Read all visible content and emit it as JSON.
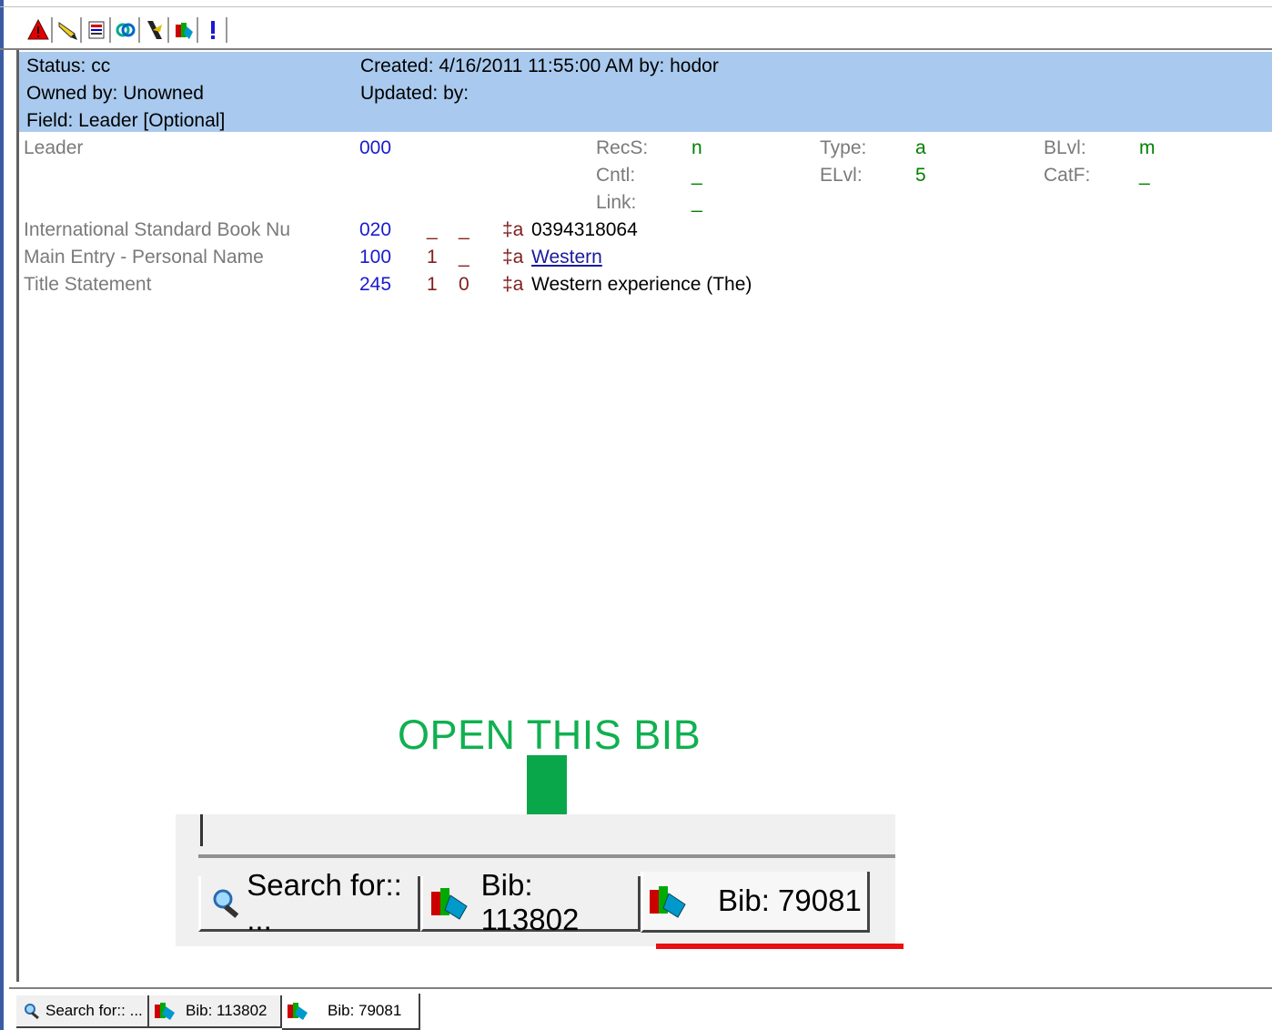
{
  "header": {
    "status": "Status: cc",
    "owned": "Owned by: Unowned",
    "field": "Field: Leader [Optional]",
    "created": "Created: 4/16/2011 11:55:00 AM by: hodor",
    "updated": "Updated:  by:"
  },
  "leader": {
    "label": "Leader",
    "tag": "000",
    "recs_label": "RecS:",
    "recs_val": "n",
    "cntl_label": "Cntl:",
    "cntl_val": "_",
    "link_label": "Link:",
    "link_val": "_",
    "type_label": "Type:",
    "type_val": "a",
    "elvl_label": "ELvl:",
    "elvl_val": "5",
    "blvl_label": "BLvl:",
    "blvl_val": "m",
    "catf_label": "CatF:",
    "catf_val": "_"
  },
  "fields": [
    {
      "label": "International Standard Book Nu",
      "tag": "020",
      "ind1": "_",
      "ind2": "_",
      "subfield": "‡a",
      "value": "0394318064"
    },
    {
      "label": "Main Entry - Personal Name",
      "tag": "100",
      "ind1": "1",
      "ind2": "_",
      "subfield": "‡a",
      "value": "Western"
    },
    {
      "label": "Title Statement",
      "tag": "245",
      "ind1": "1",
      "ind2": "0",
      "subfield": "‡a",
      "value": "Western experience (The)"
    }
  ],
  "annotation": {
    "text": "OPEN THIS BIB",
    "arrow_color": "#0aa64a",
    "underline_color": "#e81010"
  },
  "inset_tabs": [
    {
      "label": "Search for:: ...",
      "icon": "search-icon"
    },
    {
      "label": "Bib: 113802",
      "icon": "books-icon"
    },
    {
      "label": "Bib: 79081",
      "icon": "books-icon"
    }
  ],
  "bottom_tabs": [
    {
      "label": "Search for:: ...",
      "icon": "search-icon"
    },
    {
      "label": "Bib: 113802",
      "icon": "books-icon"
    },
    {
      "label": "Bib: 79081",
      "icon": "books-icon"
    }
  ],
  "toolbar": [
    "warning-icon",
    "highlighter-icon",
    "record-icon",
    "link-icon",
    "validate-icon",
    "books-icon",
    "exclamation-icon"
  ]
}
